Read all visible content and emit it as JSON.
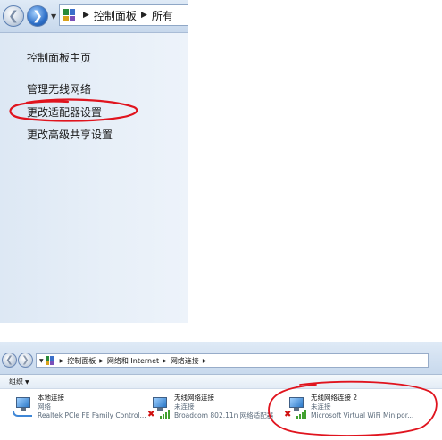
{
  "top": {
    "address": {
      "crumbs": [
        "控制面板",
        "所有"
      ]
    },
    "tasks": {
      "home": "控制面板主页",
      "wireless": "管理无线网络",
      "adapter": "更改适配器设置",
      "advanced": "更改高级共享设置"
    }
  },
  "bottom": {
    "address": {
      "crumbs": [
        "控制面板",
        "网络和 Internet",
        "网络连接"
      ]
    },
    "organize": "组织",
    "connections": [
      {
        "name": "本地连接",
        "status": "网络",
        "device": "Realtek PCIe FE Family Control..."
      },
      {
        "name": "无线网络连接",
        "status": "未连接",
        "device": "Broadcom 802.11n 网络适配器"
      },
      {
        "name": "无线网络连接 2",
        "status": "未连接",
        "device": "Microsoft Virtual WiFi Minipor..."
      }
    ]
  },
  "colors": {
    "annotation": "#e0141e",
    "accent": "#2b78c8"
  },
  "icons": {
    "back": "back-arrow-icon",
    "forward": "forward-arrow-icon",
    "control_panel": "control-panel-icon",
    "network_adapter": "network-adapter-icon",
    "disconnected": "red-x-icon",
    "signal": "signal-bars-icon"
  }
}
